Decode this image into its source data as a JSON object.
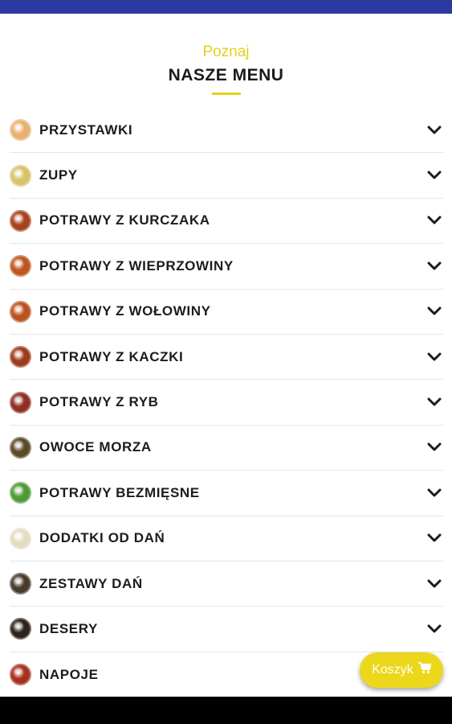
{
  "header": {
    "eyebrow": "Poznaj",
    "title": "NASZE MENU"
  },
  "colors": {
    "status_bar": "#2b3aa0",
    "accent": "#e6cf1f",
    "cart": "#ecd81a"
  },
  "menu": {
    "items": [
      {
        "label": "PRZYSTAWKI",
        "icon": "appetizer-dish",
        "swatch": "#e9b070"
      },
      {
        "label": "ZUPY",
        "icon": "soup-bowl",
        "swatch": "#d8c26a"
      },
      {
        "label": "POTRAWY Z KURCZAKA",
        "icon": "chicken-dish",
        "swatch": "#a8421f"
      },
      {
        "label": "POTRAWY Z WIEPRZOWINY",
        "icon": "pork-dish",
        "swatch": "#c0561f"
      },
      {
        "label": "POTRAWY Z WOŁOWINY",
        "icon": "beef-dish",
        "swatch": "#b9521d"
      },
      {
        "label": "POTRAWY Z KACZKI",
        "icon": "duck-dish",
        "swatch": "#9c3a1c"
      },
      {
        "label": "POTRAWY Z RYB",
        "icon": "fish-dish",
        "swatch": "#8e2f22"
      },
      {
        "label": "OWOCE MORZA",
        "icon": "seafood-dish",
        "swatch": "#5a4a26"
      },
      {
        "label": "POTRAWY BEZMIĘSNE",
        "icon": "vegetarian-dish",
        "swatch": "#4f9a35"
      },
      {
        "label": "DODATKI OD DAŃ",
        "icon": "side-dish",
        "swatch": "#e3dcc4"
      },
      {
        "label": "ZESTAWY DAŃ",
        "icon": "set-meal",
        "swatch": "#4a3a2c"
      },
      {
        "label": "DESERY",
        "icon": "dessert-dish",
        "swatch": "#2c211b"
      },
      {
        "label": "NAPOJE",
        "icon": "drink-glass",
        "swatch": "#a8301e"
      }
    ]
  },
  "cart": {
    "label": "Koszyk",
    "icon": "shopping-cart-icon"
  }
}
